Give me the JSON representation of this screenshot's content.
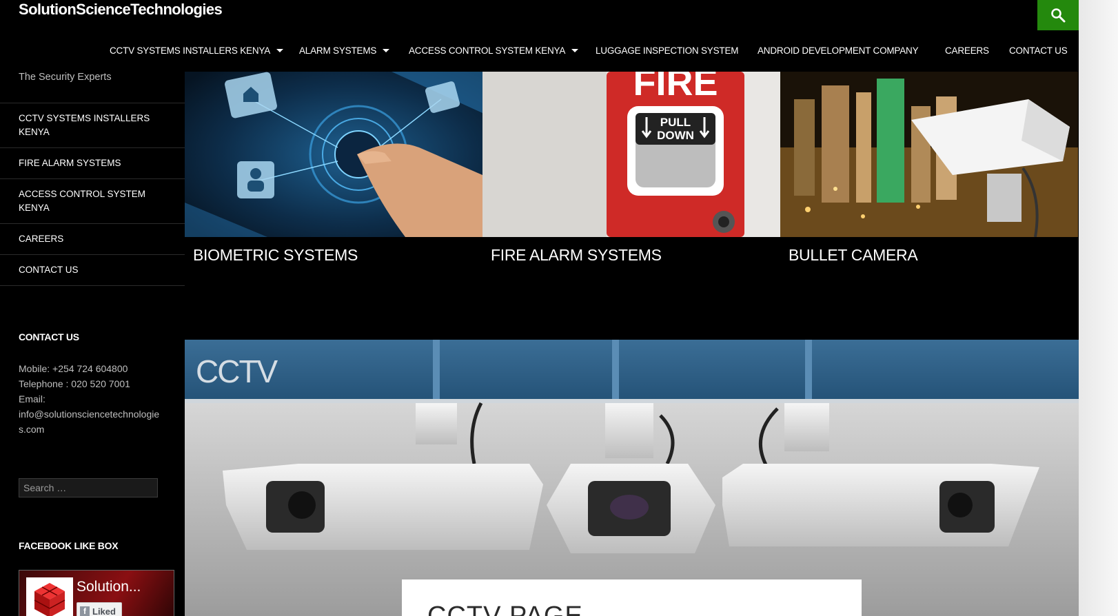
{
  "header": {
    "site_title": "SolutionScienceTechnologies",
    "accent_color": "#24890d",
    "search_icon": "search-icon"
  },
  "nav": {
    "items": [
      {
        "label": "CCTV SYSTEMS INSTALLERS KENYA",
        "has_submenu": true
      },
      {
        "label": "ALARM SYSTEMS",
        "has_submenu": true
      },
      {
        "label": "ACCESS CONTROL SYSTEM KENYA",
        "has_submenu": true
      },
      {
        "label": "LUGGAGE INSPECTION SYSTEM",
        "has_submenu": false
      },
      {
        "label": "ANDROID DEVELOPMENT COMPANY",
        "has_submenu": false
      },
      {
        "label": "CAREERS",
        "has_submenu": false
      },
      {
        "label": "CONTACT US",
        "has_submenu": false
      }
    ]
  },
  "sidebar": {
    "tagline": "The Security Experts",
    "menu": [
      {
        "label": "CCTV SYSTEMS INSTALLERS KENYA"
      },
      {
        "label": "FIRE ALARM SYSTEMS"
      },
      {
        "label": "ACCESS CONTROL SYSTEM KENYA"
      },
      {
        "label": "CAREERS"
      },
      {
        "label": "CONTACT US"
      }
    ],
    "contact": {
      "title": "CONTACT US",
      "mobile": "Mobile: +254 724 604800",
      "telephone": "Telephone : 020 520 7001",
      "email_label": "Email:",
      "email": "info@solutionsciencetechnologies.com"
    },
    "search": {
      "placeholder": "Search …"
    },
    "facebook": {
      "title": "FACEBOOK LIKE BOX",
      "page_name": "Solution...",
      "liked_label": "Liked"
    }
  },
  "featured": [
    {
      "title": "BIOMETRIC SYSTEMS"
    },
    {
      "title": "FIRE ALARM SYSTEMS",
      "sign_word": "FIRE",
      "handle_text_1": "PULL",
      "handle_text_2": "DOWN"
    },
    {
      "title": "BULLET CAMERA"
    }
  ],
  "hero": {
    "banner_text": "CCTV",
    "page_title": "CCTV PAGE"
  }
}
